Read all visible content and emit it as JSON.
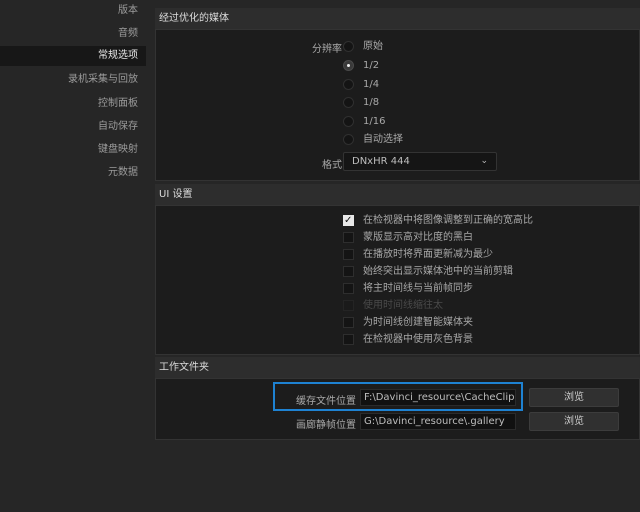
{
  "sidebar": {
    "items": [
      {
        "label": "版本",
        "active": false
      },
      {
        "label": "音频",
        "active": false
      },
      {
        "label": "常规选项",
        "active": true
      },
      {
        "label": "录机采集与回放",
        "active": false
      },
      {
        "label": "控制面板",
        "active": false
      },
      {
        "label": "自动保存",
        "active": false
      },
      {
        "label": "键盘映射",
        "active": false
      },
      {
        "label": "元数据",
        "active": false
      }
    ]
  },
  "optimized_media": {
    "title": "经过优化的媒体",
    "resolution_label": "分辨率",
    "resolution_options": [
      {
        "label": "原始",
        "selected": false
      },
      {
        "label": "1/2",
        "selected": true
      },
      {
        "label": "1/4",
        "selected": false
      },
      {
        "label": "1/8",
        "selected": false
      },
      {
        "label": "1/16",
        "selected": false
      },
      {
        "label": "自动选择",
        "selected": false
      }
    ],
    "format_label": "格式",
    "format_value": "DNxHR 444"
  },
  "ui_settings": {
    "title": "UI 设置",
    "options": [
      {
        "label": "在检视器中将图像调整到正确的宽高比",
        "checked": true,
        "disabled": false
      },
      {
        "label": "蒙版显示高对比度的黑白",
        "checked": false,
        "disabled": false
      },
      {
        "label": "在播放时将界面更新减为最少",
        "checked": false,
        "disabled": false
      },
      {
        "label": "始终突出显示媒体池中的当前剪辑",
        "checked": false,
        "disabled": false
      },
      {
        "label": "将主时间线与当前帧同步",
        "checked": false,
        "disabled": false
      },
      {
        "label": "使用时间线缩往太",
        "checked": false,
        "disabled": true
      },
      {
        "label": "为时间线创建智能媒体夹",
        "checked": false,
        "disabled": false
      },
      {
        "label": "在检视器中使用灰色背景",
        "checked": false,
        "disabled": false
      }
    ]
  },
  "working_folders": {
    "title": "工作文件夹",
    "cache_label": "缓存文件位置",
    "cache_value": "F:\\Davinci_resource\\CacheClip",
    "gallery_label": "画廊静帧位置",
    "gallery_value": "G:\\Davinci_resource\\.gallery",
    "browse_label": "浏览"
  },
  "colors": {
    "accent": "#1e82d2",
    "background": "#262626",
    "panel": "#1c1c1c"
  }
}
